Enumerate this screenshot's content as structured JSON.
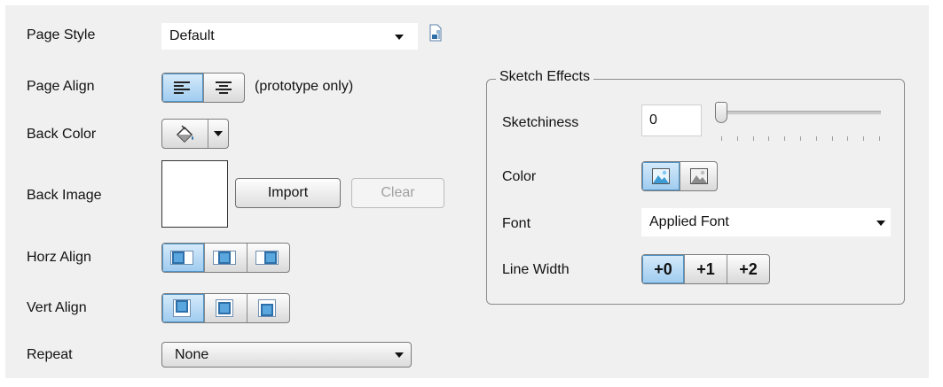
{
  "page_style": {
    "label": "Page Style",
    "value": "Default",
    "icon": "page-style-icon"
  },
  "page_align": {
    "label": "Page Align",
    "note": "(prototype only)",
    "options": [
      "align-left-icon",
      "align-center-icon"
    ],
    "selected": 0
  },
  "back_color": {
    "label": "Back Color",
    "icon": "paint-bucket-icon"
  },
  "back_image": {
    "label": "Back Image",
    "import_label": "Import",
    "clear_label": "Clear"
  },
  "horz_align": {
    "label": "Horz Align",
    "options": [
      "left",
      "center",
      "right"
    ],
    "selected": 0
  },
  "vert_align": {
    "label": "Vert Align",
    "options": [
      "top",
      "middle",
      "bottom"
    ],
    "selected": 0
  },
  "repeat": {
    "label": "Repeat",
    "value": "None"
  },
  "sketch_effects": {
    "title": "Sketch Effects",
    "sketchiness": {
      "label": "Sketchiness",
      "value": "0",
      "slider_level": 0
    },
    "color": {
      "label": "Color",
      "options": [
        "color-image-icon",
        "grayscale-image-icon"
      ],
      "selected": 0
    },
    "font": {
      "label": "Font",
      "value": "Applied Font"
    },
    "line_width": {
      "label": "Line Width",
      "options": [
        "+0",
        "+1",
        "+2"
      ],
      "selected": 0
    }
  },
  "colors": {
    "accent": "#5aa6de",
    "selected_bg": "#9ecbef",
    "panel_bg": "#f0f0f0"
  }
}
